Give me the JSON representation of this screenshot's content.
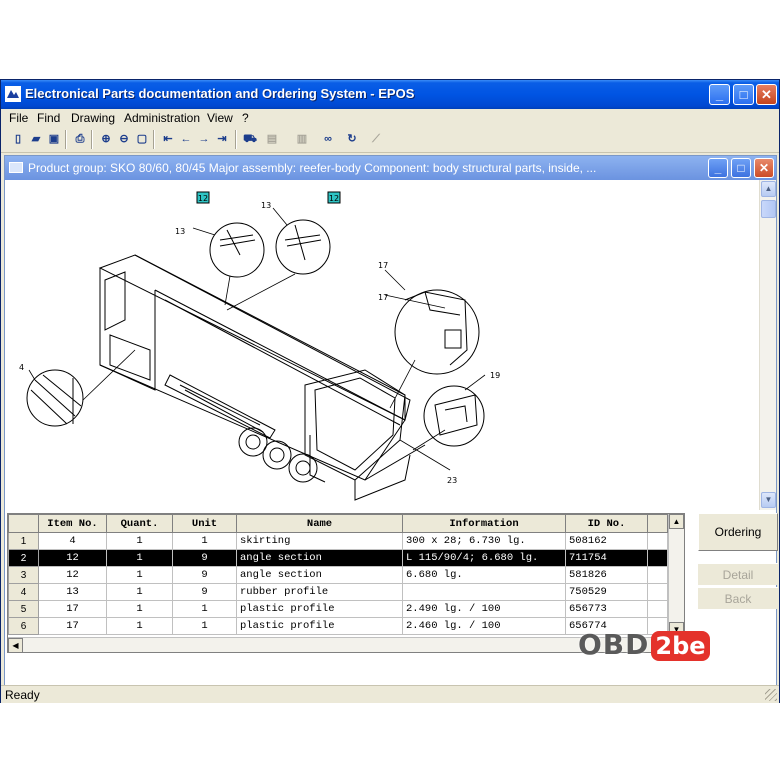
{
  "window": {
    "title": "Electronical Parts documentation and Ordering System - EPOS"
  },
  "menu": [
    "File",
    "Find",
    "Drawing",
    "Administration",
    "View",
    "?"
  ],
  "toolbar": {
    "icons": [
      "new-icon",
      "open-icon",
      "save-icon",
      "print-icon",
      "zoom-in-icon",
      "zoom-out-icon",
      "fit-page-icon",
      "first-icon",
      "prev-icon",
      "next-icon",
      "last-icon",
      "cart-icon",
      "doc-icon",
      "doc2-icon",
      "binoculars-icon",
      "refresh-icon",
      "tool-icon"
    ]
  },
  "child": {
    "title": "Product group: SKO 80/60,  80/45  Major assembly: reefer-body  Component: body structural parts, inside, ..."
  },
  "drawing": {
    "callouts": [
      "12",
      "13",
      "13",
      "12",
      "17",
      "17",
      "4",
      "19",
      "23"
    ]
  },
  "table": {
    "headers": [
      "Item No.",
      "Quant.",
      "Unit",
      "Name",
      "Information",
      "ID No."
    ],
    "rows": [
      {
        "n": "1",
        "item": "4",
        "qty": "1",
        "unit": "1",
        "name": "skirting",
        "info": "300 x 28; 6.730 lg.",
        "id": "508162"
      },
      {
        "n": "2",
        "item": "12",
        "qty": "1",
        "unit": "9",
        "name": "angle section",
        "info": "L 115/90/4; 6.680 lg.",
        "id": "711754"
      },
      {
        "n": "3",
        "item": "12",
        "qty": "1",
        "unit": "9",
        "name": "angle section",
        "info": "6.680 lg.",
        "id": "581826"
      },
      {
        "n": "4",
        "item": "13",
        "qty": "1",
        "unit": "9",
        "name": "rubber profile",
        "info": "",
        "id": "750529"
      },
      {
        "n": "5",
        "item": "17",
        "qty": "1",
        "unit": "1",
        "name": "plastic profile",
        "info": "2.490 lg. / 100",
        "id": "656773"
      },
      {
        "n": "6",
        "item": "17",
        "qty": "1",
        "unit": "1",
        "name": "plastic profile",
        "info": "2.460 lg. / 100",
        "id": "656774"
      }
    ],
    "selected_row": 2
  },
  "side": {
    "ordering": "Ordering",
    "detail": "Detail",
    "back": "Back"
  },
  "status": {
    "text": "Ready"
  },
  "watermark": {
    "part1": "OBD",
    "part2": "2be"
  }
}
